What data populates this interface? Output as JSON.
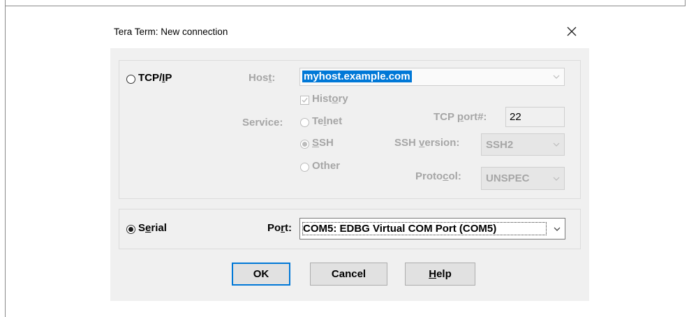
{
  "window": {
    "title": "Tera Term: New connection"
  },
  "tcpip": {
    "radio_label": "TCP/IP",
    "host_label": "Host:",
    "host_value": "myhost.example.com",
    "history_label": "History",
    "service_label": "Service:",
    "telnet_label": "Telnet",
    "ssh_label": "SSH",
    "other_label": "Other",
    "tcp_port_label": "TCP port#:",
    "tcp_port_value": "22",
    "ssh_version_label": "SSH version:",
    "ssh_version_value": "SSH2",
    "protocol_label": "Protocol:",
    "protocol_value": "UNSPEC"
  },
  "serial": {
    "radio_label": "Serial",
    "port_label": "Port:",
    "port_value": "COM5: EDBG Virtual COM Port (COM5)"
  },
  "buttons": {
    "ok": "OK",
    "cancel": "Cancel",
    "help": "Help"
  },
  "colors": {
    "selection": "#0078d7",
    "disabled_text": "#a6a6a6",
    "dialog_bg": "#f0f0f0"
  }
}
